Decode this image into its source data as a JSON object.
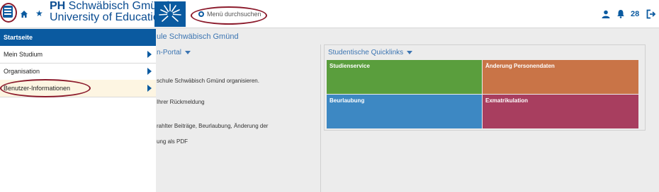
{
  "header": {
    "logo_line1_bold": "PH",
    "logo_line1_rest": " Schwäbisch Gmünd",
    "logo_line2": "University of Education",
    "search_placeholder": "Menü durchsuchen",
    "notification_count": "28",
    "icons": [
      "menu-icon",
      "home-icon",
      "star-icon",
      "search-icon",
      "user-icon",
      "bell-icon",
      "logout-icon"
    ]
  },
  "sidebar": {
    "items": [
      {
        "label": "Startseite",
        "active": true
      },
      {
        "label": "Mein Studium",
        "has_submenu": true
      },
      {
        "label": "Organisation",
        "has_submenu": true
      },
      {
        "label": "Benutzer-Informationen",
        "has_submenu": true,
        "highlighted": true
      }
    ]
  },
  "main": {
    "page_title_fragment": "ule Schwäbisch Gmünd",
    "left_panel_title_fragment": "n-Portal",
    "left_panel_lines": [
      "schule Schwäbisch Gmünd organisieren.",
      "Ihrer Rückmeldung",
      "rahlter Beiträge, Beurlaubung, Änderung der",
      "ung als PDF"
    ],
    "quicklinks_title": "Studentische Quicklinks",
    "tiles": [
      {
        "label": "Studienservice",
        "color": "#5a9e3d"
      },
      {
        "label": "Änderung Personendaten",
        "color": "#c97447"
      },
      {
        "label": "Beurlaubung",
        "color": "#3d88c3"
      },
      {
        "label": "Exmatrikulation",
        "color": "#a83e5f"
      }
    ]
  },
  "colors": {
    "brand_blue": "#0a5aa0",
    "link_blue": "#3c75b2",
    "annotation_red": "#8c1b2c",
    "highlight_bg": "#fdf5e2"
  }
}
